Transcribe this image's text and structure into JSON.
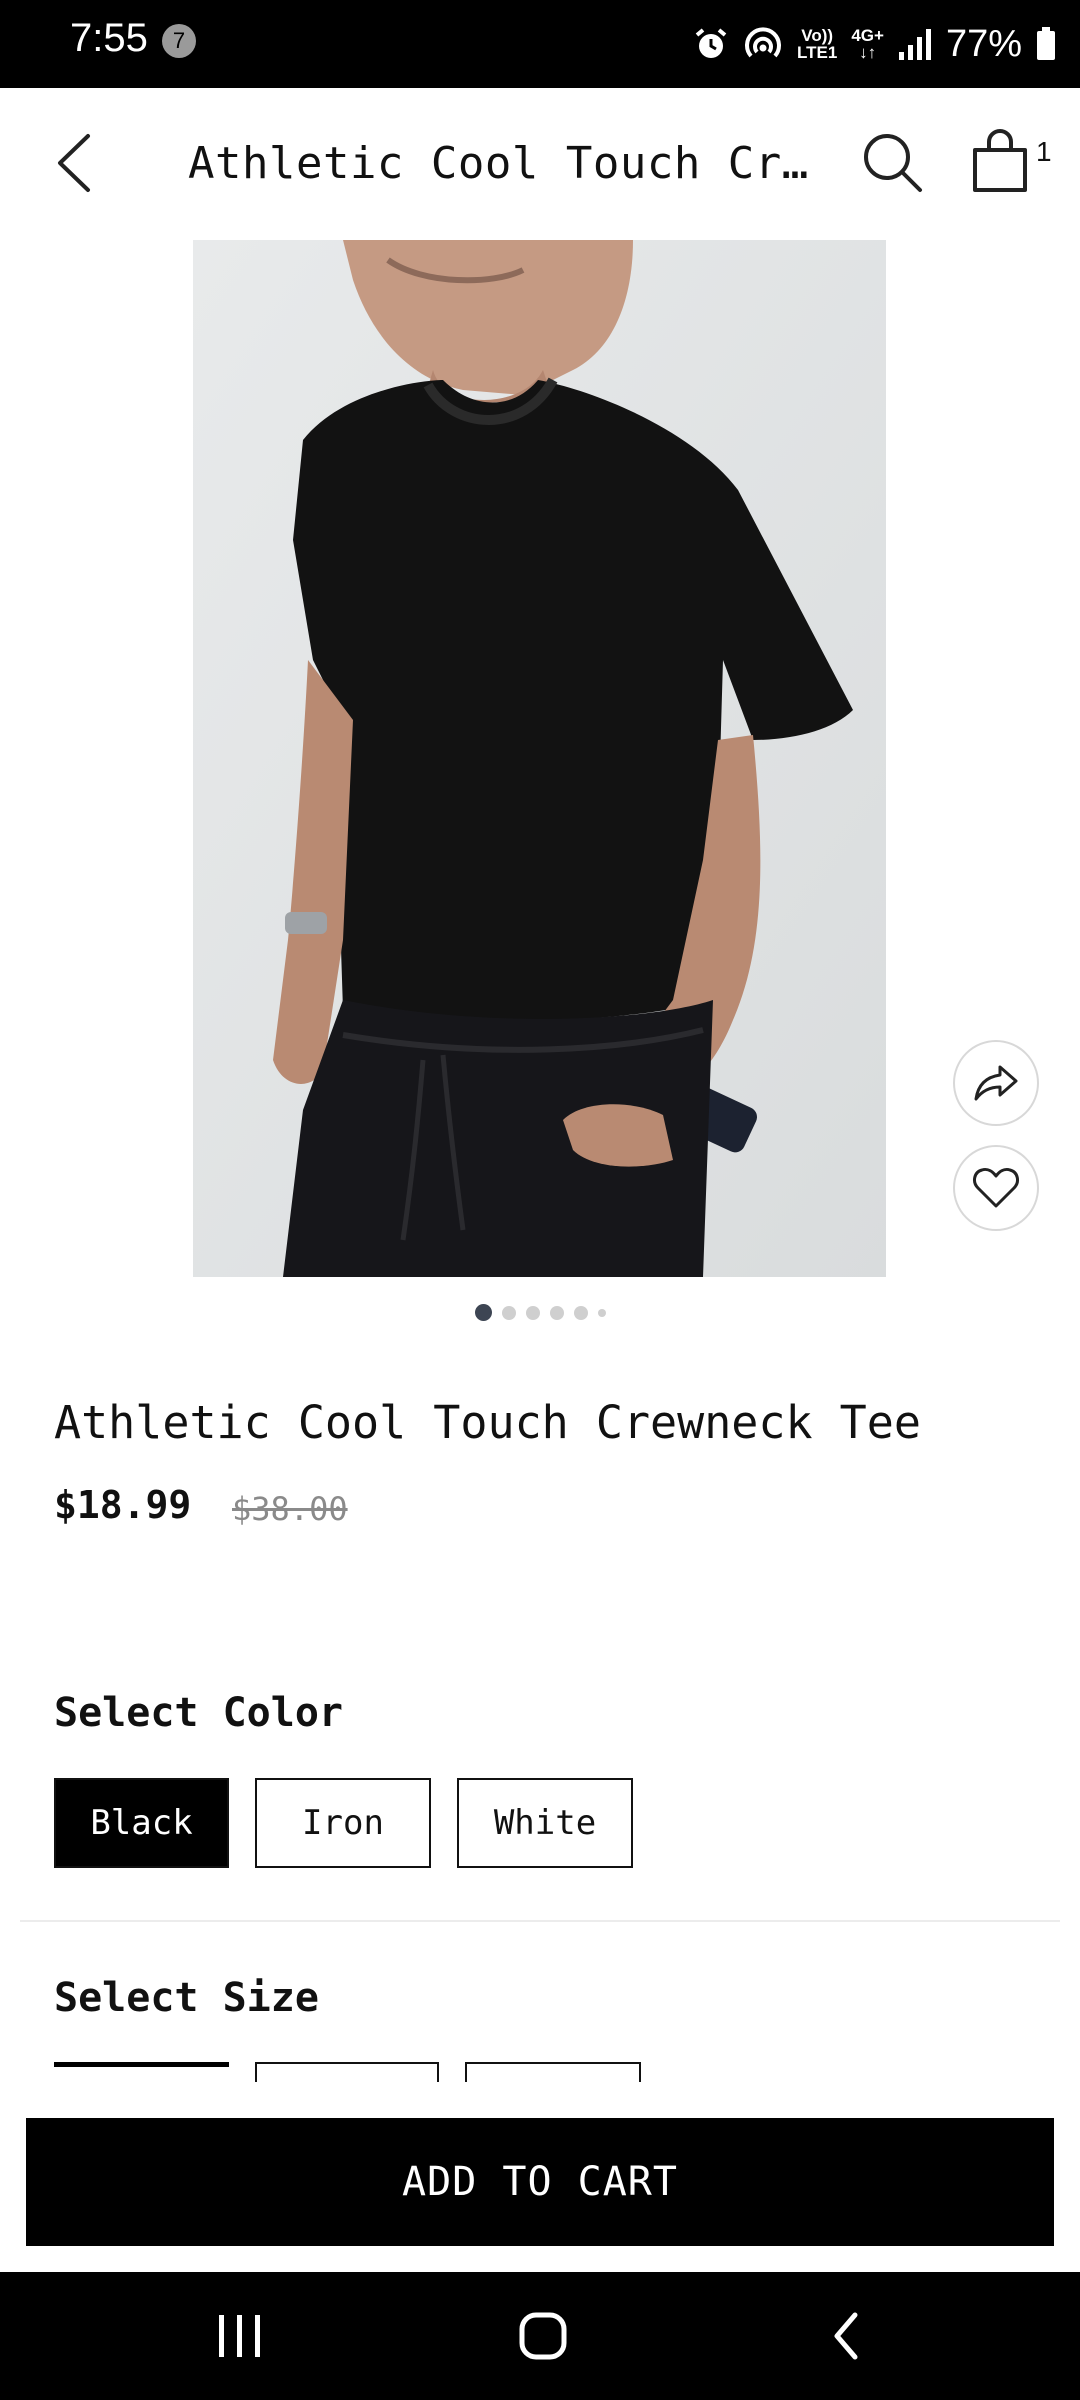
{
  "status_bar": {
    "time": "7:55",
    "notification_count": "7",
    "network_top": "Vo))",
    "network_bottom": "LTE1",
    "network_type": "4G+",
    "battery": "77%"
  },
  "header": {
    "title": "Athletic Cool Touch Crewneck Tee",
    "cart_count": "1"
  },
  "gallery": {
    "image_alt": "Man wearing black crewneck tee",
    "slide_count": 6,
    "active_slide": 1
  },
  "product": {
    "name": "Athletic Cool Touch Crewneck Tee",
    "price": "$18.99",
    "original_price": "$38.00"
  },
  "color_select": {
    "heading": "Select Color",
    "options": [
      "Black",
      "Iron",
      "White"
    ],
    "selected": "Black"
  },
  "size_select": {
    "heading": "Select Size"
  },
  "actions": {
    "add_to_cart": "ADD TO CART"
  },
  "colors": {
    "primary": "#000000",
    "background": "#ffffff",
    "strike_price": "#8a8a8a"
  }
}
